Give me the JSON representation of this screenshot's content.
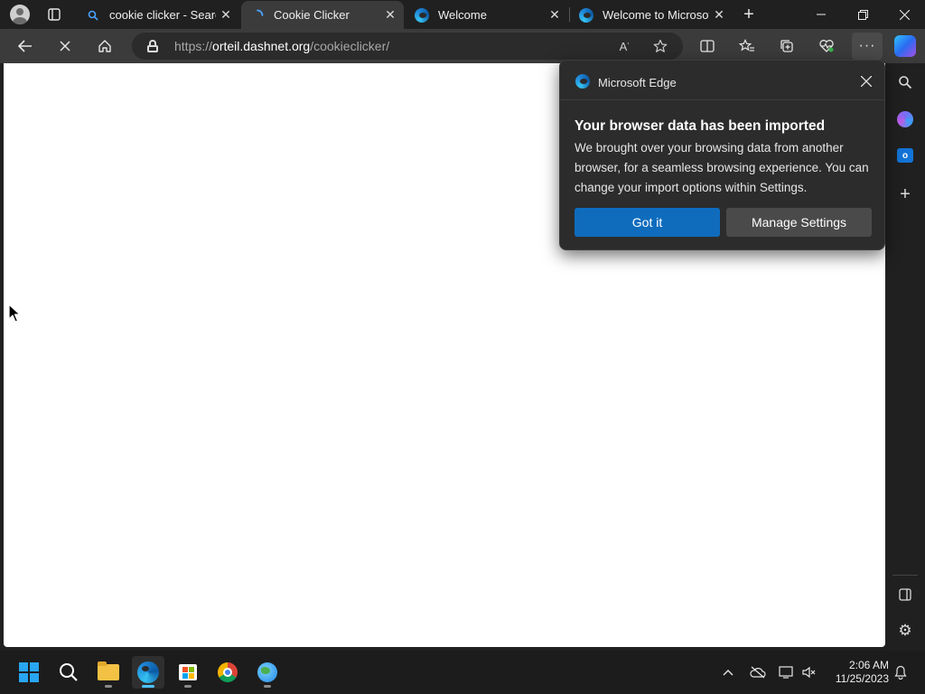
{
  "tabs": [
    {
      "title": "cookie clicker - Search",
      "icon": "search-icon",
      "active": false
    },
    {
      "title": "Cookie Clicker",
      "icon": "loading-spinner-icon",
      "active": true
    },
    {
      "title": "Welcome",
      "icon": "edge-icon",
      "active": false
    },
    {
      "title": "Welcome to Microsoft",
      "icon": "edge-icon",
      "active": false
    }
  ],
  "address_bar": {
    "url_prefix": "https://",
    "url_host": "orteil.dashnet.org",
    "url_path": "/cookieclicker/"
  },
  "popup": {
    "brand": "Microsoft Edge",
    "title": "Your browser data has been imported",
    "body": "We brought over your browsing data from another browser, for a seamless browsing experience. You can change your import options within Settings.",
    "primary_label": "Got it",
    "secondary_label": "Manage Settings"
  },
  "taskbar": {
    "time": "2:06 AM",
    "date": "11/25/2023"
  },
  "colors": {
    "accent": "#0f6cbd",
    "frame": "#202020",
    "toolbar": "#3b3b3b",
    "popup_bg": "#2c2c2c"
  }
}
